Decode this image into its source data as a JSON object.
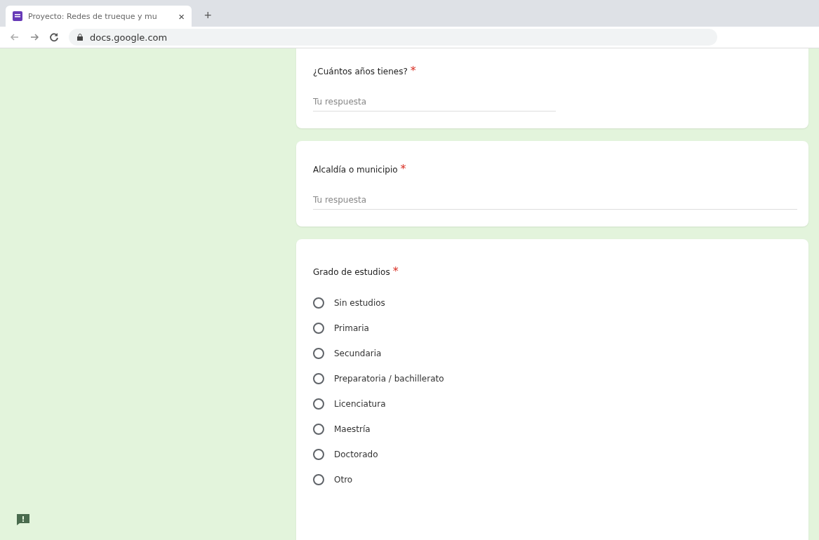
{
  "browser": {
    "tab": {
      "title": "Proyecto: Redes de trueque y mu",
      "selected": true
    },
    "close": "×",
    "new_tab": "+",
    "url": "docs.google.com"
  },
  "questions": [
    {
      "kind": "text",
      "title": "¿Cuántos años tienes?",
      "required_mark": "*",
      "placeholder": "Tu respuesta"
    },
    {
      "kind": "text",
      "title": "Alcaldía o municipio",
      "required_mark": "*",
      "placeholder": "Tu respuesta"
    },
    {
      "kind": "radio",
      "title": "Grado de estudios",
      "required_mark": "*",
      "options": [
        {
          "label": "Sin estudios",
          "selected": false
        },
        {
          "label": "Primaria",
          "selected": false
        },
        {
          "label": "Secundaria",
          "selected": false
        },
        {
          "label": "Preparatoria / bachillerato",
          "selected": false
        },
        {
          "label": "Licenciatura",
          "selected": false
        },
        {
          "label": "Maestría",
          "selected": false
        },
        {
          "label": "Doctorado",
          "selected": false
        },
        {
          "label": "Otro",
          "selected": false
        }
      ]
    }
  ]
}
